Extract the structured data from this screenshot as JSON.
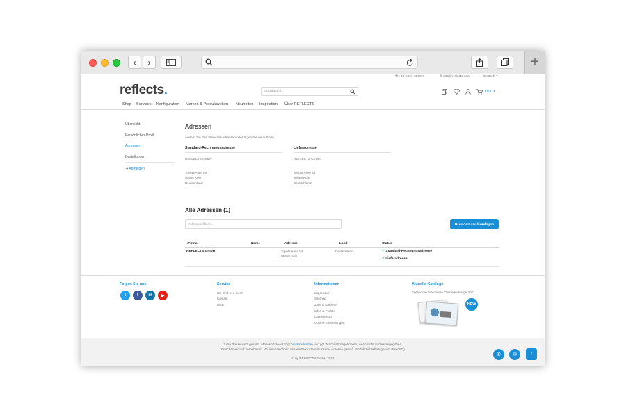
{
  "topbar": {
    "phone": "+49 2256-9900-0",
    "email": "info@reflects.com",
    "language": "Deutsch"
  },
  "header": {
    "logo": "reflects",
    "search_placeholder": "Suchbegriff...",
    "cart_total": "0,00 €"
  },
  "nav": [
    "Shop",
    "Services",
    "Konfiguration",
    "Marken & Produktwelten",
    "Neuheiten",
    "Inspiration",
    "Über REFLECTS"
  ],
  "sidebar": {
    "items": [
      "Übersicht",
      "Persönliches Profil",
      "Adressen",
      "Bestellungen"
    ],
    "logout": "Abmelden"
  },
  "main": {
    "title": "Adressen",
    "subtitle": "Ändern Sie Ihre Standard-Adressen oder fügen Sie neue hinzu.",
    "billing": {
      "heading": "Standard-Rechnungsadresse",
      "company": "REFLECTS GmbH",
      "street": "Toyota Allee 54",
      "city": "50858 Köln",
      "country": "Deutschland"
    },
    "shipping": {
      "heading": "Lieferadresse",
      "company": "REFLECTS GmbH",
      "street": "Toyota Allee 54",
      "city": "50858 Köln",
      "country": "Deutschland"
    },
    "all_title": "Alle Adressen (1)",
    "filter_placeholder": "Adressen filtern ...",
    "add_button": "Neue Adresse hinzufügen",
    "table": {
      "headers": [
        "Firma",
        "Name",
        "Adresse",
        "Land",
        "Status"
      ],
      "row": {
        "company": "REFLECTS GmbH",
        "name": "",
        "street": "Toyota Allee 54",
        "city": "50858 Köln",
        "country": "Deutschland",
        "status1": "Standard-Rechnungsadresse",
        "status2": "Lieferadresse"
      }
    }
  },
  "footer": {
    "follow": "Folgen Sie uns!",
    "social": [
      "t",
      "f",
      "in",
      "▶"
    ],
    "service_title": "Service",
    "service_links": [
      "Sie sind neu hier?",
      "Kontakt",
      "AGB"
    ],
    "info_title": "Informationen",
    "info_links": [
      "Impressum",
      "Sitemap",
      "Jobs & Karriere",
      "Infos & Presse",
      "Datenschutz",
      "Cookie-Einstellungen"
    ],
    "catalog_title": "Aktuelle Kataloge",
    "catalog_text": "Entdecken Sie unsere Online-Kataloge 2021",
    "new_badge": "NEW",
    "legal_prefix": "* Alle Preise exkl. gesetzl. Mehrwertsteuer zzgl.",
    "legal_link": "Versandkosten",
    "legal_suffix": "und ggf. Nachnahmegebühren, wenn nicht anders angegeben.",
    "legal_line2": "Zwischenverkauf vorbehalten. Wir kennzeichnen unsere Produkte mit unserer Adresse gemäß Produktsicherheitsgesetz (ProdSG).",
    "copyright": "© by REFLECTS GmbH 2022"
  },
  "colors": {
    "accent": "#1a8fd6",
    "chrome": "#e9e9e9"
  }
}
